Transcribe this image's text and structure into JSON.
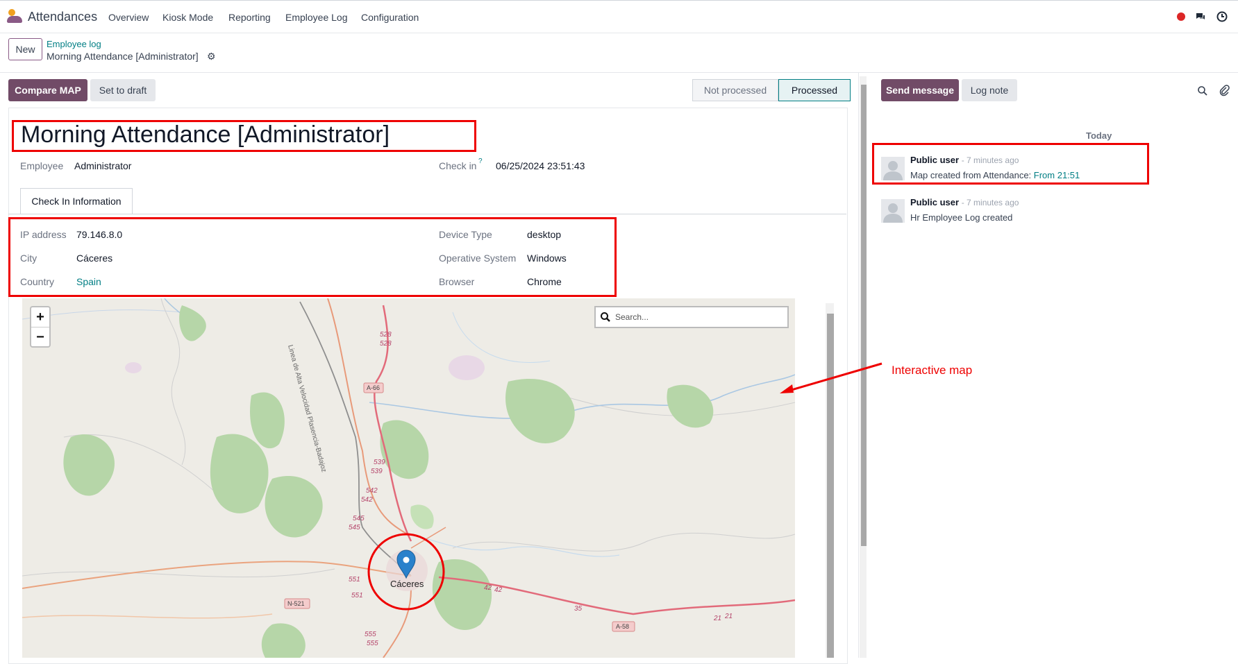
{
  "app": {
    "name": "Attendances"
  },
  "nav": [
    "Overview",
    "Kiosk Mode",
    "Reporting",
    "Employee Log",
    "Configuration"
  ],
  "breadcrumb": {
    "new_label": "New",
    "parent": "Employee log",
    "current": "Morning Attendance [Administrator]"
  },
  "toolbar": {
    "compare_label": "Compare MAP",
    "draft_label": "Set to draft"
  },
  "statusbar": {
    "stages": [
      "Not processed",
      "Processed"
    ],
    "active": "Processed"
  },
  "record": {
    "title": "Morning Attendance [Administrator]",
    "employee_label": "Employee",
    "employee": "Administrator",
    "checkin_label": "Check in",
    "checkin_help": "?",
    "checkin": "06/25/2024 23:51:43"
  },
  "tabs": [
    "Check In Information"
  ],
  "info": {
    "ip_label": "IP address",
    "ip": "79.146.8.0",
    "city_label": "City",
    "city": "Cáceres",
    "country_label": "Country",
    "country": "Spain",
    "device_label": "Device Type",
    "device": "desktop",
    "os_label": "Operative System",
    "os": "Windows",
    "browser_label": "Browser",
    "browser": "Chrome"
  },
  "map": {
    "zoom_in": "+",
    "zoom_out": "−",
    "search_placeholder": "Search...",
    "marker_label": "Cáceres",
    "road_labels": [
      "A-66",
      "N-521",
      "A-58",
      "528",
      "528",
      "539",
      "539",
      "542",
      "542",
      "545",
      "545",
      "551",
      "551",
      "555",
      "555",
      "42",
      "42",
      "35",
      "21",
      "21",
      "Linea de Alta Velocidad Plasencia-Badajoz"
    ]
  },
  "chatter": {
    "send_label": "Send message",
    "log_label": "Log note",
    "today": "Today",
    "messages": [
      {
        "author": "Public user",
        "time": "- 7 minutes ago",
        "body": "Map created from Attendance: ",
        "link": "From 21:51"
      },
      {
        "author": "Public user",
        "time": "- 7 minutes ago",
        "body": "Hr Employee Log created"
      }
    ]
  },
  "annotation": "Interactive map",
  "colors": {
    "primary": "#714b67",
    "link": "#017e84",
    "highlight": "#ee0000"
  }
}
